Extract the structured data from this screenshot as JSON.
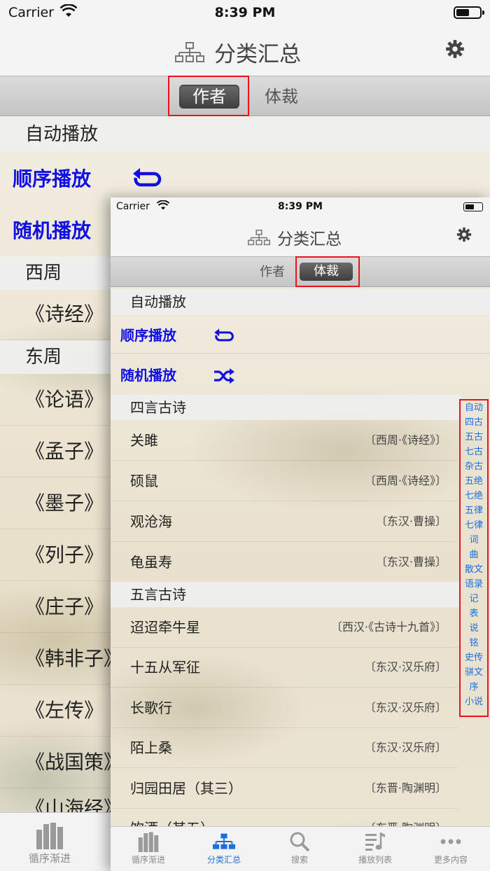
{
  "status": {
    "carrier": "Carrier",
    "time": "8:39 PM"
  },
  "back": {
    "title": "分类汇总",
    "segments": [
      "作者",
      "体裁"
    ],
    "auto_play_header": "自动播放",
    "sequential_play": "顺序播放",
    "random_play": "随机播放",
    "sections": [
      {
        "title": "西周",
        "items": [
          "《诗经》"
        ]
      },
      {
        "title": "东周",
        "items": [
          "《论语》",
          "《孟子》",
          "《墨子》",
          "《列子》",
          "《庄子》",
          "《韩非子》",
          "《左传》",
          "《战国策》",
          "《山海经》"
        ]
      }
    ],
    "tab_label": "循序渐进"
  },
  "front": {
    "title": "分类汇总",
    "segments": [
      "作者",
      "体裁"
    ],
    "auto_play_header": "自动播放",
    "sequential_play": "顺序播放",
    "random_play": "随机播放",
    "sections": [
      {
        "title": "四言古诗",
        "items": [
          {
            "title": "关雎",
            "source": "〔西周·《诗经》〕"
          },
          {
            "title": "硕鼠",
            "source": "〔西周·《诗经》〕"
          },
          {
            "title": "观沧海",
            "source": "〔东汉·曹操〕"
          },
          {
            "title": "龟虽寿",
            "source": "〔东汉·曹操〕"
          }
        ]
      },
      {
        "title": "五言古诗",
        "items": [
          {
            "title": "迢迢牵牛星",
            "source": "〔西汉·《古诗十九首》〕"
          },
          {
            "title": "十五从军征",
            "source": "〔东汉·汉乐府〕"
          },
          {
            "title": "长歌行",
            "source": "〔东汉·汉乐府〕"
          },
          {
            "title": "陌上桑",
            "source": "〔东汉·汉乐府〕"
          },
          {
            "title": "归园田居（其三）",
            "source": "〔东晋·陶渊明〕"
          },
          {
            "title": "饮酒（其五）",
            "source": "〔东晋·陶渊明〕"
          }
        ]
      }
    ],
    "index": [
      "自动",
      "四古",
      "五古",
      "七古",
      "杂古",
      "五绝",
      "七绝",
      "五律",
      "七律",
      "词",
      "曲",
      "散文",
      "语录",
      "记",
      "表",
      "说",
      "铭",
      "史传",
      "骈文",
      "序",
      "小说"
    ],
    "tabs": [
      "循序渐进",
      "分类汇总",
      "搜索",
      "播放列表",
      "更多内容"
    ]
  },
  "colors": {
    "accent": "#1a6fe0",
    "play_text": "#1010e0",
    "highlight_box": "#e8141a"
  }
}
